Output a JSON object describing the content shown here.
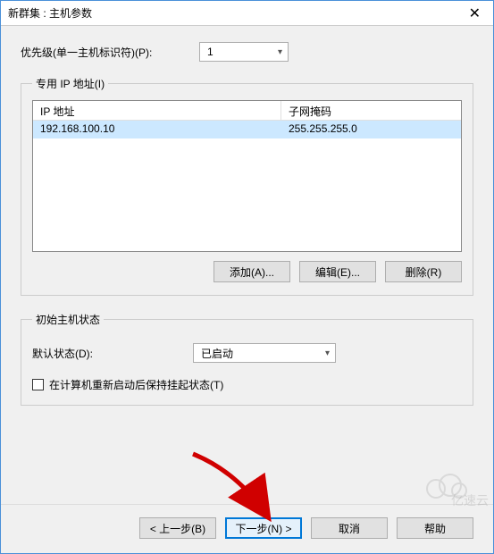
{
  "titlebar": {
    "title": "新群集 : 主机参数",
    "close_glyph": "✕"
  },
  "priority": {
    "label": "优先级(单一主机标识符)(P):",
    "value": "1"
  },
  "ip_group": {
    "legend": "专用 IP 地址(I)",
    "col_ip": "IP 地址",
    "col_mask": "子网掩码",
    "rows": [
      {
        "ip": "192.168.100.10",
        "mask": "255.255.255.0"
      }
    ]
  },
  "ip_buttons": {
    "add": "添加(A)...",
    "edit": "编辑(E)...",
    "remove": "删除(R)"
  },
  "initial_state": {
    "legend": "初始主机状态",
    "default_label": "默认状态(D):",
    "default_value": "已启动",
    "checkbox_label": "在计算机重新启动后保持挂起状态(T)",
    "checked": false
  },
  "footer": {
    "back": "< 上一步(B)",
    "next": "下一步(N) >",
    "cancel": "取消",
    "help": "帮助"
  },
  "watermark": "亿速云"
}
